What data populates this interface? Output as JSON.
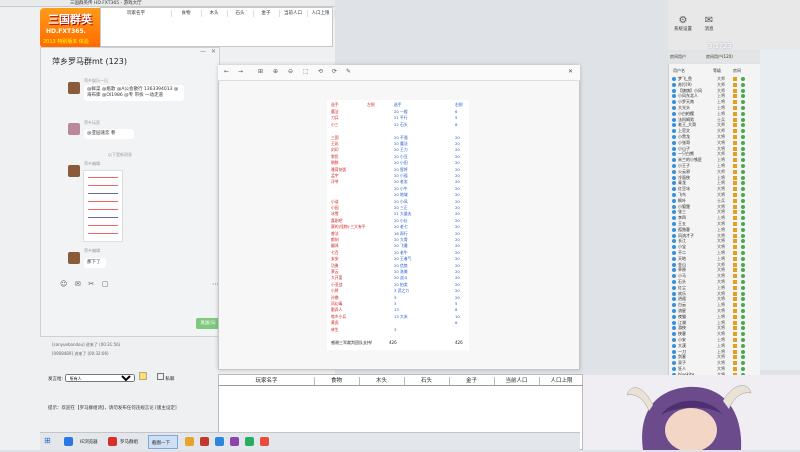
{
  "game": {
    "window_title": "三国群英传 HD.FXT365 - 游戏大厅",
    "logo_line1": "三国群英",
    "logo_line2": "HD.FXT365.",
    "logo_line3": "2013 特别版本 体验",
    "small_sheet_headers": [
      "玩家名字",
      "食物",
      "木头",
      "石头",
      "金子",
      "当前人口",
      "人口上限"
    ]
  },
  "chat": {
    "title": "萍乡罗马群mt (123)",
    "minimize": "—",
    "close": "✕",
    "messages": [
      {
        "nick": "萍乡娱乐一日",
        "text": "@鲜菜 @瓶歌 @A公会散行 1363394013 @海布库 @OI1986 @专 带拆 一动走道"
      },
      {
        "nick": "萍乡玩家",
        "text": "@亚园速恋 巷"
      },
      {
        "divider": "以下是新消息"
      },
      {
        "nick": "萍乡编辑",
        "text": ""
      },
      {
        "nick": "萍乡编辑",
        "text": "那下了"
      }
    ],
    "toolbar_icons": [
      "☺",
      "✉",
      "✂",
      "▢"
    ],
    "more": "⋯",
    "send": "发送(S)",
    "system_log": [
      "[sanyuebandou] 进来了 (00:31:56)",
      "[0908489] 进来了 (00:32:06)"
    ],
    "speak_label": "发言给:",
    "speak_target": "所有人",
    "checkbox_label": "私聊",
    "notice": "提示：欢迎在【罗马群组诗】，请勿发布任何违规言论 [版主设定]"
  },
  "viewer": {
    "toolbar": [
      "←",
      "→",
      "⊞",
      "⊕",
      "⊖",
      "⬚",
      "⟲",
      "⟳",
      "✎",
      "✕"
    ],
    "sheet_header": [
      "选手",
      "左侧",
      "选手",
      "右侧"
    ],
    "rows": [
      [
        "魔法",
        "",
        "20 一般",
        "6"
      ],
      [
        "刀兵",
        "",
        "21 平行",
        "5"
      ],
      [
        "小三",
        "",
        "22 石头",
        "8"
      ],
      [
        "",
        "",
        "",
        ""
      ],
      [
        "三国",
        "",
        "20 不强",
        "20"
      ],
      [
        "王彩",
        "",
        "20 魔法",
        "20"
      ],
      [
        "封印",
        "",
        "20 王力",
        "20"
      ],
      [
        "黎民",
        "",
        "20 小豆",
        "20"
      ],
      [
        "朝鲜",
        "",
        "20 小田",
        "20"
      ],
      [
        "雅荷刻弧",
        "",
        "20 智将",
        "20"
      ],
      [
        "孟宇",
        "",
        "20 小孤",
        "20"
      ],
      [
        "浮爷",
        "",
        "20 老忠",
        "20"
      ],
      [
        "",
        "",
        "20 小牛",
        "20"
      ],
      [
        "",
        "",
        "20 地域",
        "20"
      ],
      [
        "小谈",
        "",
        "20 小风",
        "20"
      ],
      [
        "小园",
        "",
        "20 三正",
        "20"
      ],
      [
        "冰雪",
        "",
        "21 大量夫",
        "20"
      ],
      [
        "喜剧吧",
        "",
        "20 小灶",
        "20"
      ],
      [
        "赛的(怪物)·三大有平",
        "",
        "20 老七",
        "20"
      ],
      [
        "曾法",
        "",
        "16 再行",
        "20"
      ],
      [
        "都刻",
        "",
        "20 大骨",
        "20"
      ],
      [
        "翻译",
        "",
        "20 飞雅",
        "20"
      ],
      [
        "七百",
        "",
        "20 老牛",
        "20"
      ],
      [
        "安安",
        "",
        "20 王者气",
        "20"
      ],
      [
        "功勇",
        "",
        "20 信势",
        "20"
      ],
      [
        "萝云",
        "",
        "20 洛美",
        "20"
      ],
      [
        "大开爱",
        "",
        "20 战斗",
        "20"
      ],
      [
        "小亚战",
        "",
        "20 拍卖",
        "20"
      ],
      [
        "小将",
        "",
        "3 武之力",
        "20"
      ],
      [
        "孙鼎",
        "",
        "3",
        "20"
      ],
      [
        "凤幻毒",
        "",
        "3",
        "5"
      ],
      [
        "勤弄人",
        "",
        "13",
        "6"
      ],
      [
        "喧乡小兵",
        "",
        "13 大米",
        "10"
      ],
      [
        "黄虎",
        "",
        "",
        "6"
      ],
      [
        "林生",
        "",
        "3",
        ""
      ]
    ],
    "footer_left": "感谢三军裁判团队支持!",
    "footer_total_left": "426",
    "footer_total_right": "426"
  },
  "bottom_sheet": {
    "headers": [
      "玩家名字",
      "食物",
      "木头",
      "石头",
      "金子",
      "当前人口",
      "人口上限"
    ]
  },
  "right_panel": {
    "tools": [
      {
        "icon": "⚙",
        "label": "系统设置"
      },
      {
        "icon": "✉",
        "label": "消息"
      }
    ],
    "counter": "3.1?23",
    "tabs": [
      "房间用户",
      "房间用户(120)"
    ],
    "col_headers": [
      "用户名",
      "等级",
      "房间"
    ],
    "users": [
      [
        "梦飞_鱼",
        "大师"
      ],
      [
        "苏打(9)",
        "大师"
      ],
      [
        "【旗旗】小风",
        "大师"
      ],
      [
        "小风东北人",
        "上将"
      ],
      [
        "小罗天南",
        "上将"
      ],
      [
        "大光头",
        "上将"
      ],
      [
        "小白柏樱",
        "上将"
      ],
      [
        "法科姆男",
        "士兵"
      ],
      [
        "老王_大哥",
        "大师"
      ],
      [
        "上官文",
        "大师"
      ],
      [
        "小黑龙",
        "大将"
      ],
      [
        "小张哥",
        "大将"
      ],
      [
        "小山子",
        "大将"
      ],
      [
        "一只白熊",
        "大师"
      ],
      [
        "米兰的小铁匠",
        "上将"
      ],
      [
        "小王子",
        "上将"
      ],
      [
        "火云邪",
        "大师"
      ],
      [
        "冷面侠",
        "上将"
      ],
      [
        "青龙",
        "上将"
      ],
      [
        "红豆冰",
        "大将"
      ],
      [
        "飞鸟",
        "大将"
      ],
      [
        "枫叶",
        "士兵"
      ],
      [
        "小狐狸",
        "大将"
      ],
      [
        "张三",
        "大将"
      ],
      [
        "李四",
        "上将"
      ],
      [
        "王五",
        "大将"
      ],
      [
        "孤独客",
        "上将"
      ],
      [
        "风流才子",
        "大将"
      ],
      [
        "长江",
        "大将"
      ],
      [
        "小宝",
        "大将"
      ],
      [
        "不二",
        "上将"
      ],
      [
        "天地",
        "上将"
      ],
      [
        "金山",
        "大师"
      ],
      [
        "草原",
        "大将"
      ],
      [
        "小马",
        "大将"
      ],
      [
        "石头",
        "大将"
      ],
      [
        "红尘",
        "上将"
      ],
      [
        "欢乐",
        "大将"
      ],
      [
        "逍遥",
        "大将"
      ],
      [
        "白云",
        "上将"
      ],
      [
        "流星",
        "大将"
      ],
      [
        "夜猫",
        "上将"
      ],
      [
        "江湖",
        "上将"
      ],
      [
        "游侠",
        "大将"
      ],
      [
        "侠客",
        "大将"
      ],
      [
        "小安",
        "上将"
      ],
      [
        "大漠",
        "上将"
      ],
      [
        "一刀",
        "上将"
      ],
      [
        "剑客",
        "大将"
      ],
      [
        "双子",
        "大将"
      ],
      [
        "狂人",
        "大将"
      ],
      [
        "bluekite",
        "大将"
      ]
    ]
  },
  "taskbar": {
    "start": "⊞",
    "items": [
      {
        "label": "IE浏览器",
        "color": "#2b78e4"
      },
      {
        "label": "罗马群组",
        "color": "#d7302b"
      },
      {
        "label": "",
        "color": "#3b6fd1"
      }
    ],
    "active_label": "截图一下"
  }
}
